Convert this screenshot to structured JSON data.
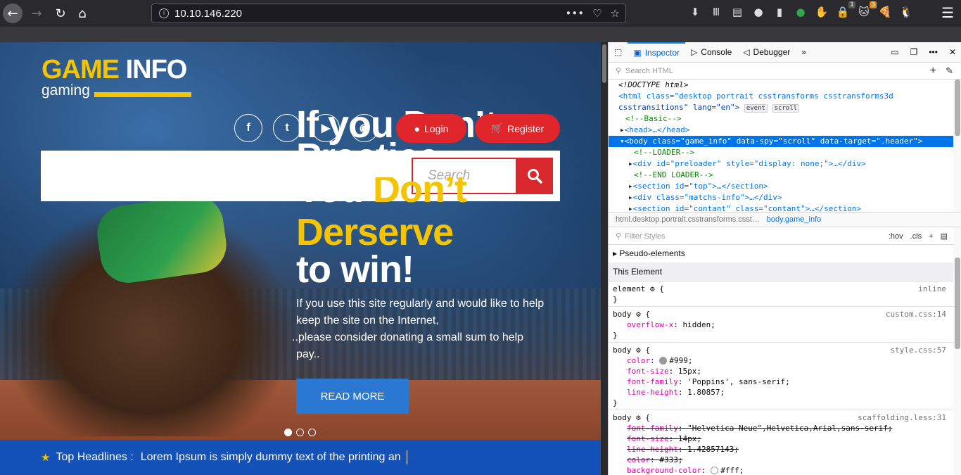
{
  "browser": {
    "url": "10.10.146.220",
    "info_icon": "i",
    "url_actions": [
      "•••",
      "♡",
      "☆"
    ],
    "extension_icons": [
      "⬇",
      "Ⅲ",
      "▤",
      "●",
      "▮",
      "●",
      "✋",
      "🔒",
      "🐱",
      "🍕",
      "🐧"
    ],
    "badge_1": "1",
    "badge_3": "3",
    "menu_icon": "☰"
  },
  "site": {
    "logo_part1": "GAME",
    "logo_part2": "INFO",
    "logo_sub": "gaming",
    "social": [
      "f",
      "t",
      "▶",
      "◉"
    ],
    "login_label": "Login",
    "register_label": "Register",
    "headline_lines": [
      "If you Don’t",
      "Practice",
      "You Don’t",
      "Derserve",
      "to win!"
    ],
    "search_placeholder": "Search",
    "blurb_lines": [
      "If you use this site regularly and would like to help",
      "keep the site on the Internet,",
      "..please consider donating a small sum to help",
      "pay.."
    ],
    "read_more": "READ MORE",
    "ticker_label": "Top Headlines :",
    "ticker_text": "Lorem Ipsum is simply dummy text of the printing an"
  },
  "devtools": {
    "tabs": [
      "Inspector",
      "Console",
      "Debugger"
    ],
    "search_placeholder": "Search HTML",
    "markup": [
      "<!DOCTYPE html>",
      "<html class=\"desktop portrait csstransforms csstransforms3d",
      "csstransitions\" lang=\"en\">",
      "<!--Basic-->",
      "<head>…</head>",
      "<body class=\"game_info\" data-spy=\"scroll\" data-target=\".header\">",
      "<!--LOADER-->",
      "<div id=\"preloader\" style=\"display: none;\">…</div>",
      "<!--END LOADER-->",
      "<section id=\"top\">…</section>",
      "<div class=\"matchs-info\">…</div>",
      "<section id=\"contant\" class=\"contant\">…</section>"
    ],
    "badges": [
      "event",
      "scroll"
    ],
    "crumb_1": "html.desktop.portrait.csstransforms.csst…",
    "crumb_2": "body.game_info",
    "filter_placeholder": "Filter Styles",
    "filter_buttons": [
      ":hov",
      ".cls",
      "+"
    ],
    "pseudo": "Pseudo-elements",
    "this_element": "This Element",
    "rules": [
      {
        "selector": "element",
        "source": "inline",
        "props": []
      },
      {
        "selector": "body",
        "source": "custom.css:14",
        "props": [
          {
            "name": "overflow-x",
            "value": "hidden"
          }
        ]
      },
      {
        "selector": "body",
        "source": "style.css:57",
        "props": [
          {
            "name": "color",
            "value": "#999"
          },
          {
            "name": "font-size",
            "value": "15px"
          },
          {
            "name": "font-family",
            "value": "'Poppins', sans-serif"
          },
          {
            "name": "line-height",
            "value": "1.80857"
          }
        ]
      },
      {
        "selector": "body",
        "source": "scaffolding.less:31",
        "props": [
          {
            "name": "font-family",
            "value": "\"Helvetica Neue\",Helvetica,Arial,sans-serif"
          },
          {
            "name": "font-size",
            "value": "14px"
          },
          {
            "name": "line-height",
            "value": "1.42857143"
          },
          {
            "name": "color",
            "value": "#333"
          },
          {
            "name": "background-color",
            "value": "#fff"
          }
        ]
      }
    ]
  }
}
